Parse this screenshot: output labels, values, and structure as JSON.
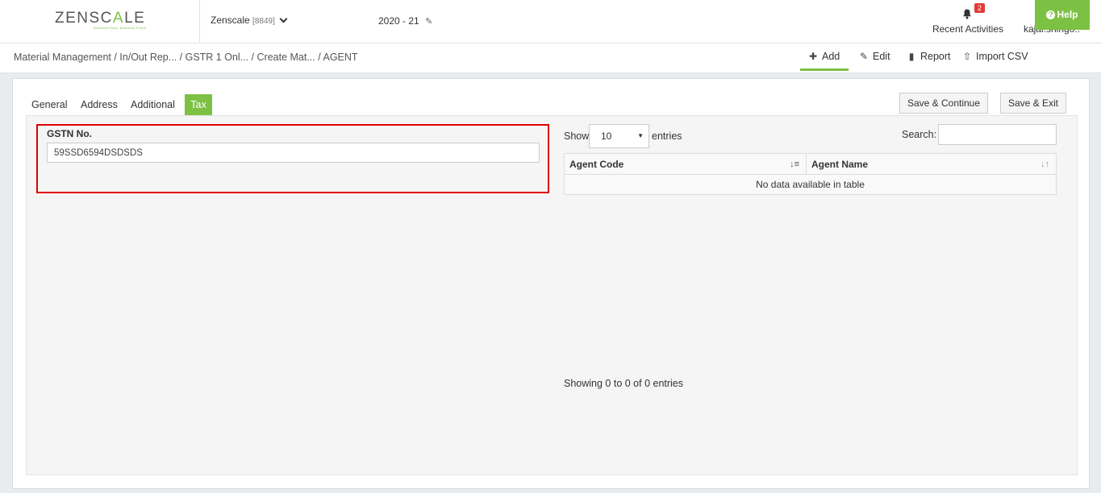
{
  "header": {
    "logo_prefix": "ZENSC",
    "logo_accent": "A",
    "logo_suffix": "LE",
    "logo_tagline": "Business Easy. Business Focus.",
    "company_name": "Zenscale",
    "company_code": "[8849]",
    "financial_year": "2020 - 21",
    "notifications_count": "2",
    "notifications_label": "Recent Activities",
    "user_name": "kajal.shingo.."
  },
  "breadcrumb": "Material Management  / In/Out Rep... / GSTR 1 Onl... / Create Mat... / AGENT",
  "toolbar": {
    "add_label": "Add",
    "edit_label": "Edit",
    "report_label": "Report",
    "import_label": "Import CSV",
    "help_label": "Help"
  },
  "tabs": [
    "General",
    "Address",
    "Additional",
    "Tax"
  ],
  "active_tab": "Tax",
  "buttons": {
    "save_continue": "Save & Continue",
    "save_exit": "Save & Exit"
  },
  "form": {
    "gstn_label": "GSTN No.",
    "gstn_value": "59SSD6594DSDSDS"
  },
  "table": {
    "show_label": "Show",
    "page_size": "10",
    "entries_label": "entries",
    "search_label": "Search:",
    "columns": [
      "Agent Code",
      "Agent Name"
    ],
    "empty_message": "No data available in table",
    "info": "Showing 0 to 0 of 0 entries"
  },
  "colors": {
    "accent": "#7cc144",
    "highlight_border": "#e00000",
    "badge": "#e03b3b"
  }
}
